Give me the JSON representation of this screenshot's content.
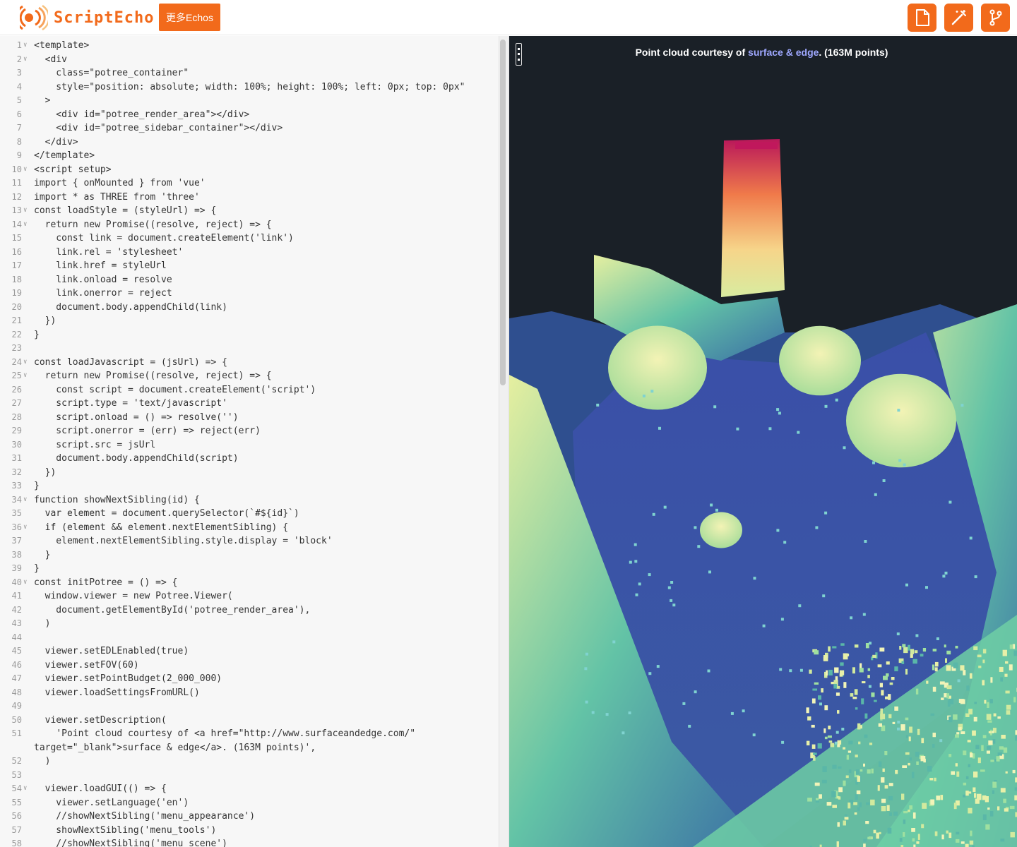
{
  "header": {
    "brand": "ScriptEcho",
    "more_label": "更多Echos",
    "tools": [
      {
        "icon": "file-icon",
        "name": "file"
      },
      {
        "icon": "magic-wand-icon",
        "name": "magic-wand"
      },
      {
        "icon": "branch-icon",
        "name": "branch"
      }
    ]
  },
  "editor": {
    "lines": [
      {
        "n": "1",
        "fold": true,
        "text": "<template>"
      },
      {
        "n": "2",
        "fold": true,
        "text": "  <div"
      },
      {
        "n": "3",
        "text": "    class=\"potree_container\""
      },
      {
        "n": "4",
        "text": "    style=\"position: absolute; width: 100%; height: 100%; left: 0px; top: 0px\""
      },
      {
        "n": "5",
        "text": "  >"
      },
      {
        "n": "6",
        "text": "    <div id=\"potree_render_area\"></div>"
      },
      {
        "n": "7",
        "text": "    <div id=\"potree_sidebar_container\"></div>"
      },
      {
        "n": "8",
        "text": "  </div>"
      },
      {
        "n": "9",
        "text": "</template>"
      },
      {
        "n": "10",
        "fold": true,
        "text": "<script setup>"
      },
      {
        "n": "11",
        "text": "import { onMounted } from 'vue'"
      },
      {
        "n": "12",
        "text": "import * as THREE from 'three'"
      },
      {
        "n": "13",
        "fold": true,
        "text": "const loadStyle = (styleUrl) => {"
      },
      {
        "n": "14",
        "fold": true,
        "text": "  return new Promise((resolve, reject) => {"
      },
      {
        "n": "15",
        "text": "    const link = document.createElement('link')"
      },
      {
        "n": "16",
        "text": "    link.rel = 'stylesheet'"
      },
      {
        "n": "17",
        "text": "    link.href = styleUrl"
      },
      {
        "n": "18",
        "text": "    link.onload = resolve"
      },
      {
        "n": "19",
        "text": "    link.onerror = reject"
      },
      {
        "n": "20",
        "text": "    document.body.appendChild(link)"
      },
      {
        "n": "21",
        "text": "  })"
      },
      {
        "n": "22",
        "text": "}"
      },
      {
        "n": "23",
        "text": ""
      },
      {
        "n": "24",
        "fold": true,
        "text": "const loadJavascript = (jsUrl) => {"
      },
      {
        "n": "25",
        "fold": true,
        "text": "  return new Promise((resolve, reject) => {"
      },
      {
        "n": "26",
        "text": "    const script = document.createElement('script')"
      },
      {
        "n": "27",
        "text": "    script.type = 'text/javascript'"
      },
      {
        "n": "28",
        "text": "    script.onload = () => resolve('')"
      },
      {
        "n": "29",
        "text": "    script.onerror = (err) => reject(err)"
      },
      {
        "n": "30",
        "text": "    script.src = jsUrl"
      },
      {
        "n": "31",
        "text": "    document.body.appendChild(script)"
      },
      {
        "n": "32",
        "text": "  })"
      },
      {
        "n": "33",
        "text": "}"
      },
      {
        "n": "34",
        "fold": true,
        "text": "function showNextSibling(id) {"
      },
      {
        "n": "35",
        "text": "  var element = document.querySelector(`#${id}`)"
      },
      {
        "n": "36",
        "fold": true,
        "text": "  if (element && element.nextElementSibling) {"
      },
      {
        "n": "37",
        "text": "    element.nextElementSibling.style.display = 'block'"
      },
      {
        "n": "38",
        "text": "  }"
      },
      {
        "n": "39",
        "text": "}"
      },
      {
        "n": "40",
        "fold": true,
        "text": "const initPotree = () => {"
      },
      {
        "n": "41",
        "text": "  window.viewer = new Potree.Viewer("
      },
      {
        "n": "42",
        "text": "    document.getElementById('potree_render_area'),"
      },
      {
        "n": "43",
        "text": "  )"
      },
      {
        "n": "44",
        "text": ""
      },
      {
        "n": "45",
        "text": "  viewer.setEDLEnabled(true)"
      },
      {
        "n": "46",
        "text": "  viewer.setFOV(60)"
      },
      {
        "n": "47",
        "text": "  viewer.setPointBudget(2_000_000)"
      },
      {
        "n": "48",
        "text": "  viewer.loadSettingsFromURL()"
      },
      {
        "n": "49",
        "text": ""
      },
      {
        "n": "50",
        "text": "  viewer.setDescription("
      },
      {
        "n": "51",
        "wrap": true,
        "text": "    'Point cloud courtesy of <a href=\"http://www.surfaceandedge.com/\"\ntarget=\"_blank\">surface & edge</a>. (163M points)',"
      },
      {
        "n": "52",
        "text": "  )"
      },
      {
        "n": "53",
        "text": ""
      },
      {
        "n": "54",
        "fold": true,
        "text": "  viewer.loadGUI(() => {"
      },
      {
        "n": "55",
        "text": "    viewer.setLanguage('en')"
      },
      {
        "n": "56",
        "text": "    //showNextSibling('menu_appearance')"
      },
      {
        "n": "57",
        "text": "    showNextSibling('menu_tools')"
      },
      {
        "n": "58",
        "text": "    //showNextSibling('menu_scene')"
      }
    ]
  },
  "viewer": {
    "desc_prefix": "Point cloud courtesy of ",
    "desc_link": "surface & edge",
    "desc_suffix": ". (163M points)"
  },
  "colors": {
    "accent": "#f26a1b",
    "viewer_bg": "#1a2027",
    "link": "#9fa8ff"
  }
}
